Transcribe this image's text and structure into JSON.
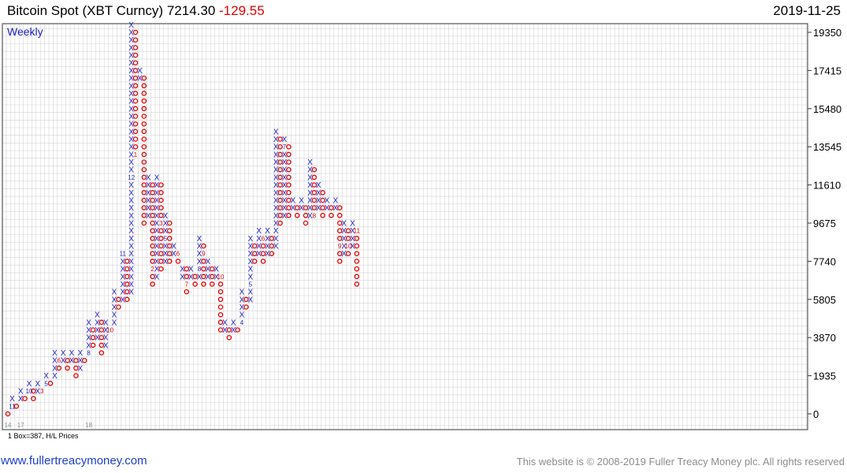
{
  "header": {
    "title": "Bitcoin Spot (XBT Curncy)",
    "last": "7214.30",
    "change": "-129.55",
    "date": "2019-11-25"
  },
  "footer": {
    "link": "www.fullertreacymoney.com",
    "copyright": "This website is © 2008-2019 Fuller Treacy Money plc. All rights reserved"
  },
  "colors": {
    "x": "#1a1acc",
    "o": "#e00000",
    "grid": "#d4d4d4",
    "frame": "#333333",
    "muted": "#8c8c8c"
  },
  "chart_data": {
    "type": "point-and-figure",
    "period_label": "Weekly",
    "box_note": "1 Box=387, H/L Prices",
    "box_size": 387,
    "yticks": [
      0,
      1935,
      3870,
      5805,
      7740,
      9675,
      11610,
      13545,
      15480,
      17415,
      19350
    ],
    "ylim": [
      -387,
      20124
    ],
    "year_labels": [
      {
        "text": "14",
        "col": 0
      },
      {
        "text": "17",
        "col": 3
      },
      {
        "text": "18",
        "col": 19
      }
    ],
    "columns": [
      {
        "t": "O",
        "lo": 0,
        "hi": 0,
        "m": []
      },
      {
        "t": "X",
        "lo": 1,
        "hi": 2,
        "m": [
          {
            "b": 1,
            "s": "11"
          }
        ]
      },
      {
        "t": "O",
        "lo": 1,
        "hi": 1,
        "m": []
      },
      {
        "t": "X",
        "lo": 2,
        "hi": 3,
        "m": []
      },
      {
        "t": "O",
        "lo": 2,
        "hi": 2,
        "m": []
      },
      {
        "t": "X",
        "lo": 3,
        "hi": 4,
        "m": [
          {
            "b": 3,
            "s": "10"
          }
        ]
      },
      {
        "t": "O",
        "lo": 2,
        "hi": 3,
        "m": []
      },
      {
        "t": "X",
        "lo": 3,
        "hi": 4,
        "m": []
      },
      {
        "t": "O",
        "lo": 3,
        "hi": 3,
        "m": [
          {
            "b": 3,
            "s": "3"
          }
        ]
      },
      {
        "t": "X",
        "lo": 4,
        "hi": 5,
        "m": [
          {
            "b": 4,
            "s": "5"
          }
        ]
      },
      {
        "t": "O",
        "lo": 4,
        "hi": 4,
        "m": []
      },
      {
        "t": "X",
        "lo": 5,
        "hi": 8,
        "m": []
      },
      {
        "t": "O",
        "lo": 6,
        "hi": 7,
        "m": [
          {
            "b": 7,
            "s": "6"
          }
        ]
      },
      {
        "t": "X",
        "lo": 7,
        "hi": 8,
        "m": []
      },
      {
        "t": "O",
        "lo": 6,
        "hi": 7,
        "m": []
      },
      {
        "t": "X",
        "lo": 7,
        "hi": 8,
        "m": []
      },
      {
        "t": "O",
        "lo": 5,
        "hi": 7,
        "m": []
      },
      {
        "t": "X",
        "lo": 6,
        "hi": 8,
        "m": []
      },
      {
        "t": "O",
        "lo": 7,
        "hi": 7,
        "m": []
      },
      {
        "t": "X",
        "lo": 8,
        "hi": 12,
        "m": [
          {
            "b": 8,
            "s": "8"
          }
        ]
      },
      {
        "t": "O",
        "lo": 9,
        "hi": 11,
        "m": []
      },
      {
        "t": "X",
        "lo": 10,
        "hi": 13,
        "m": []
      },
      {
        "t": "O",
        "lo": 8,
        "hi": 12,
        "m": []
      },
      {
        "t": "X",
        "lo": 9,
        "hi": 12,
        "m": []
      },
      {
        "t": "O",
        "lo": 11,
        "hi": 11,
        "m": [
          {
            "b": 11,
            "s": "10"
          }
        ]
      },
      {
        "t": "X",
        "lo": 12,
        "hi": 16,
        "m": []
      },
      {
        "t": "O",
        "lo": 14,
        "hi": 15,
        "m": []
      },
      {
        "t": "X",
        "lo": 15,
        "hi": 21,
        "m": [
          {
            "b": 21,
            "s": "11"
          }
        ]
      },
      {
        "t": "O",
        "lo": 15,
        "hi": 20,
        "m": []
      },
      {
        "t": "X",
        "lo": 16,
        "hi": 51,
        "m": [
          {
            "b": 31,
            "s": "12"
          }
        ]
      },
      {
        "t": "O",
        "lo": 34,
        "hi": 50,
        "m": [
          {
            "b": 34,
            "s": "1"
          }
        ]
      },
      {
        "t": "X",
        "lo": 44,
        "hi": 45,
        "m": []
      },
      {
        "t": "O",
        "lo": 25,
        "hi": 44,
        "m": []
      },
      {
        "t": "X",
        "lo": 26,
        "hi": 31,
        "m": []
      },
      {
        "t": "O",
        "lo": 17,
        "hi": 30,
        "m": [
          {
            "b": 19,
            "s": "2"
          }
        ]
      },
      {
        "t": "X",
        "lo": 18,
        "hi": 31,
        "m": []
      },
      {
        "t": "O",
        "lo": 19,
        "hi": 30,
        "m": [
          {
            "b": 18,
            "s": "4"
          },
          {
            "b": 25,
            "s": "3"
          }
        ]
      },
      {
        "t": "X",
        "lo": 20,
        "hi": 26,
        "m": [
          {
            "b": 23,
            "s": "5"
          }
        ]
      },
      {
        "t": "O",
        "lo": 20,
        "hi": 25,
        "m": []
      },
      {
        "t": "X",
        "lo": 21,
        "hi": 22,
        "m": []
      },
      {
        "t": "O",
        "lo": 20,
        "hi": 21,
        "m": [
          {
            "b": 21,
            "s": "6"
          }
        ]
      },
      {
        "t": "X",
        "lo": 18,
        "hi": 19,
        "m": []
      },
      {
        "t": "O",
        "lo": 16,
        "hi": 19,
        "m": [
          {
            "b": 17,
            "s": "7"
          }
        ]
      },
      {
        "t": "X",
        "lo": 18,
        "hi": 19,
        "m": []
      },
      {
        "t": "O",
        "lo": 17,
        "hi": 18,
        "m": []
      },
      {
        "t": "X",
        "lo": 18,
        "hi": 23,
        "m": [
          {
            "b": 19,
            "s": "8"
          }
        ]
      },
      {
        "t": "O",
        "lo": 17,
        "hi": 22,
        "m": [
          {
            "b": 21,
            "s": "9"
          }
        ]
      },
      {
        "t": "X",
        "lo": 18,
        "hi": 20,
        "m": []
      },
      {
        "t": "O",
        "lo": 17,
        "hi": 19,
        "m": []
      },
      {
        "t": "X",
        "lo": 18,
        "hi": 19,
        "m": []
      },
      {
        "t": "O",
        "lo": 11,
        "hi": 18,
        "m": [
          {
            "b": 18,
            "s": "10"
          },
          {
            "b": 10,
            "s": "12"
          }
        ]
      },
      {
        "t": "X",
        "lo": 11,
        "hi": 12,
        "m": []
      },
      {
        "t": "O",
        "lo": 10,
        "hi": 11,
        "m": []
      },
      {
        "t": "X",
        "lo": 11,
        "hi": 12,
        "m": []
      },
      {
        "t": "O",
        "lo": 11,
        "hi": 11,
        "m": []
      },
      {
        "t": "X",
        "lo": 12,
        "hi": 16,
        "m": [
          {
            "b": 12,
            "s": "4"
          }
        ]
      },
      {
        "t": "O",
        "lo": 14,
        "hi": 15,
        "m": []
      },
      {
        "t": "X",
        "lo": 15,
        "hi": 23,
        "m": [
          {
            "b": 17,
            "s": "5"
          }
        ]
      },
      {
        "t": "O",
        "lo": 20,
        "hi": 22,
        "m": []
      },
      {
        "t": "X",
        "lo": 21,
        "hi": 24,
        "m": []
      },
      {
        "t": "O",
        "lo": 20,
        "hi": 23,
        "m": [
          {
            "b": 23,
            "s": "6"
          }
        ]
      },
      {
        "t": "X",
        "lo": 21,
        "hi": 24,
        "m": []
      },
      {
        "t": "O",
        "lo": 21,
        "hi": 23,
        "m": []
      },
      {
        "t": "X",
        "lo": 22,
        "hi": 37,
        "m": []
      },
      {
        "t": "O",
        "lo": 25,
        "hi": 36,
        "m": []
      },
      {
        "t": "X",
        "lo": 26,
        "hi": 36,
        "m": [
          {
            "b": 35,
            "s": "7"
          }
        ]
      },
      {
        "t": "O",
        "lo": 26,
        "hi": 35,
        "m": []
      },
      {
        "t": "X",
        "lo": 27,
        "hi": 28,
        "m": []
      },
      {
        "t": "O",
        "lo": 26,
        "hi": 27,
        "m": []
      },
      {
        "t": "X",
        "lo": 27,
        "hi": 28,
        "m": []
      },
      {
        "t": "O",
        "lo": 25,
        "hi": 27,
        "m": []
      },
      {
        "t": "X",
        "lo": 26,
        "hi": 33,
        "m": []
      },
      {
        "t": "O",
        "lo": 26,
        "hi": 32,
        "m": [
          {
            "b": 26,
            "s": "8"
          }
        ]
      },
      {
        "t": "X",
        "lo": 27,
        "hi": 30,
        "m": []
      },
      {
        "t": "O",
        "lo": 26,
        "hi": 29,
        "m": []
      },
      {
        "t": "X",
        "lo": 27,
        "hi": 28,
        "m": []
      },
      {
        "t": "O",
        "lo": 26,
        "hi": 27,
        "m": []
      },
      {
        "t": "X",
        "lo": 27,
        "hi": 28,
        "m": []
      },
      {
        "t": "O",
        "lo": 20,
        "hi": 27,
        "m": [
          {
            "b": 22,
            "s": "9"
          }
        ]
      },
      {
        "t": "X",
        "lo": 21,
        "hi": 25,
        "m": []
      },
      {
        "t": "O",
        "lo": 21,
        "hi": 24,
        "m": [
          {
            "b": 22,
            "s": "10"
          }
        ]
      },
      {
        "t": "X",
        "lo": 22,
        "hi": 25,
        "m": []
      },
      {
        "t": "O",
        "lo": 17,
        "hi": 24,
        "m": [
          {
            "b": 24,
            "s": "11"
          }
        ]
      }
    ]
  }
}
